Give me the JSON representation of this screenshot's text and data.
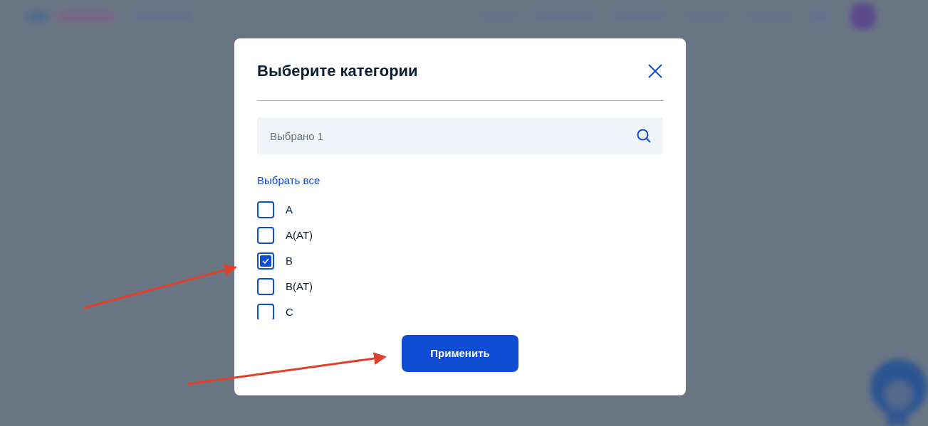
{
  "dialog": {
    "title": "Выберите категории",
    "search": {
      "placeholder": "Выбрано 1"
    },
    "select_all": "Выбрать все",
    "categories": [
      {
        "label": "A",
        "checked": false
      },
      {
        "label": "A(AT)",
        "checked": false
      },
      {
        "label": "B",
        "checked": true
      },
      {
        "label": "B(AT)",
        "checked": false
      },
      {
        "label": "C",
        "checked": false
      }
    ],
    "apply_button": "Применить"
  }
}
